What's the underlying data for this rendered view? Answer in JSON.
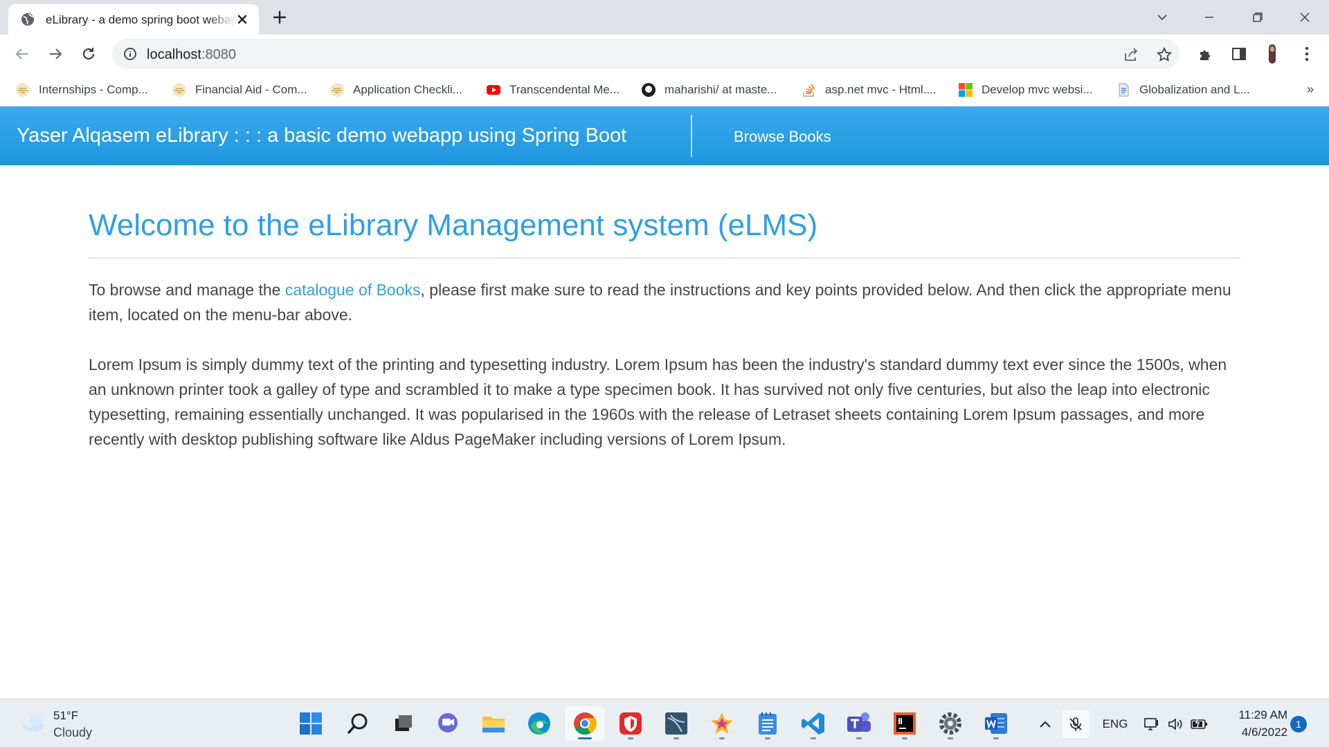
{
  "browser": {
    "tab": {
      "title": "eLibrary - a demo spring boot webapp"
    },
    "url": {
      "host": "localhost",
      "port": ":8080"
    },
    "bookmarks": [
      {
        "label": "Internships - Comp...",
        "icon": "university-seal-icon"
      },
      {
        "label": "Financial Aid - Com...",
        "icon": "university-seal-icon"
      },
      {
        "label": "Application Checkli...",
        "icon": "university-seal-icon"
      },
      {
        "label": "Transcendental Me...",
        "icon": "youtube-icon"
      },
      {
        "label": "maharishi/ at maste...",
        "icon": "github-icon"
      },
      {
        "label": "asp.net mvc - Html....",
        "icon": "stackoverflow-icon"
      },
      {
        "label": "Develop mvc websi...",
        "icon": "microsoft-icon"
      },
      {
        "label": "Globalization and L...",
        "icon": "document-icon"
      }
    ],
    "bookmarks_more": "»"
  },
  "site": {
    "brand": "Yaser Alqasem eLibrary : : : a basic demo webapp using Spring Boot",
    "nav_link": "Browse Books",
    "heading": "Welcome to the eLibrary Management system (eLMS)",
    "intro_before": "To browse and manage the ",
    "intro_link": "catalogue of Books",
    "intro_after": ", please first make sure to read the instructions and key points provided below. And then click the appropriate menu item, located on the menu-bar above.",
    "lorem": "Lorem Ipsum is simply dummy text of the printing and typesetting industry. Lorem Ipsum has been the industry's standard dummy text ever since the 1500s, when an unknown printer took a galley of type and scrambled it to make a type specimen book. It has survived not only five centuries, but also the leap into electronic typesetting, remaining essentially unchanged. It was popularised in the 1960s with the release of Letraset sheets containing Lorem Ipsum passages, and more recently with desktop publishing software like Aldus PageMaker including versions of Lorem Ipsum."
  },
  "taskbar": {
    "weather_temp": "51°F",
    "weather_desc": "Cloudy",
    "apps": [
      "start-icon",
      "search-icon",
      "task-view-icon",
      "chat-icon",
      "file-explorer-icon",
      "edge-icon",
      "chrome-icon",
      "antivirus-icon",
      "mysql-workbench-icon",
      "star-app-icon",
      "notepad-icon",
      "vscode-icon",
      "teams-icon",
      "intellij-icon",
      "settings-icon",
      "word-icon"
    ],
    "language": "ENG",
    "time": "11:29 AM",
    "date": "4/6/2022",
    "notification_count": "1"
  },
  "colors": {
    "navbar": "#2aa0e6",
    "heading": "#2f9fe3",
    "link": "#2f9fe3",
    "body_text": "#444444"
  }
}
